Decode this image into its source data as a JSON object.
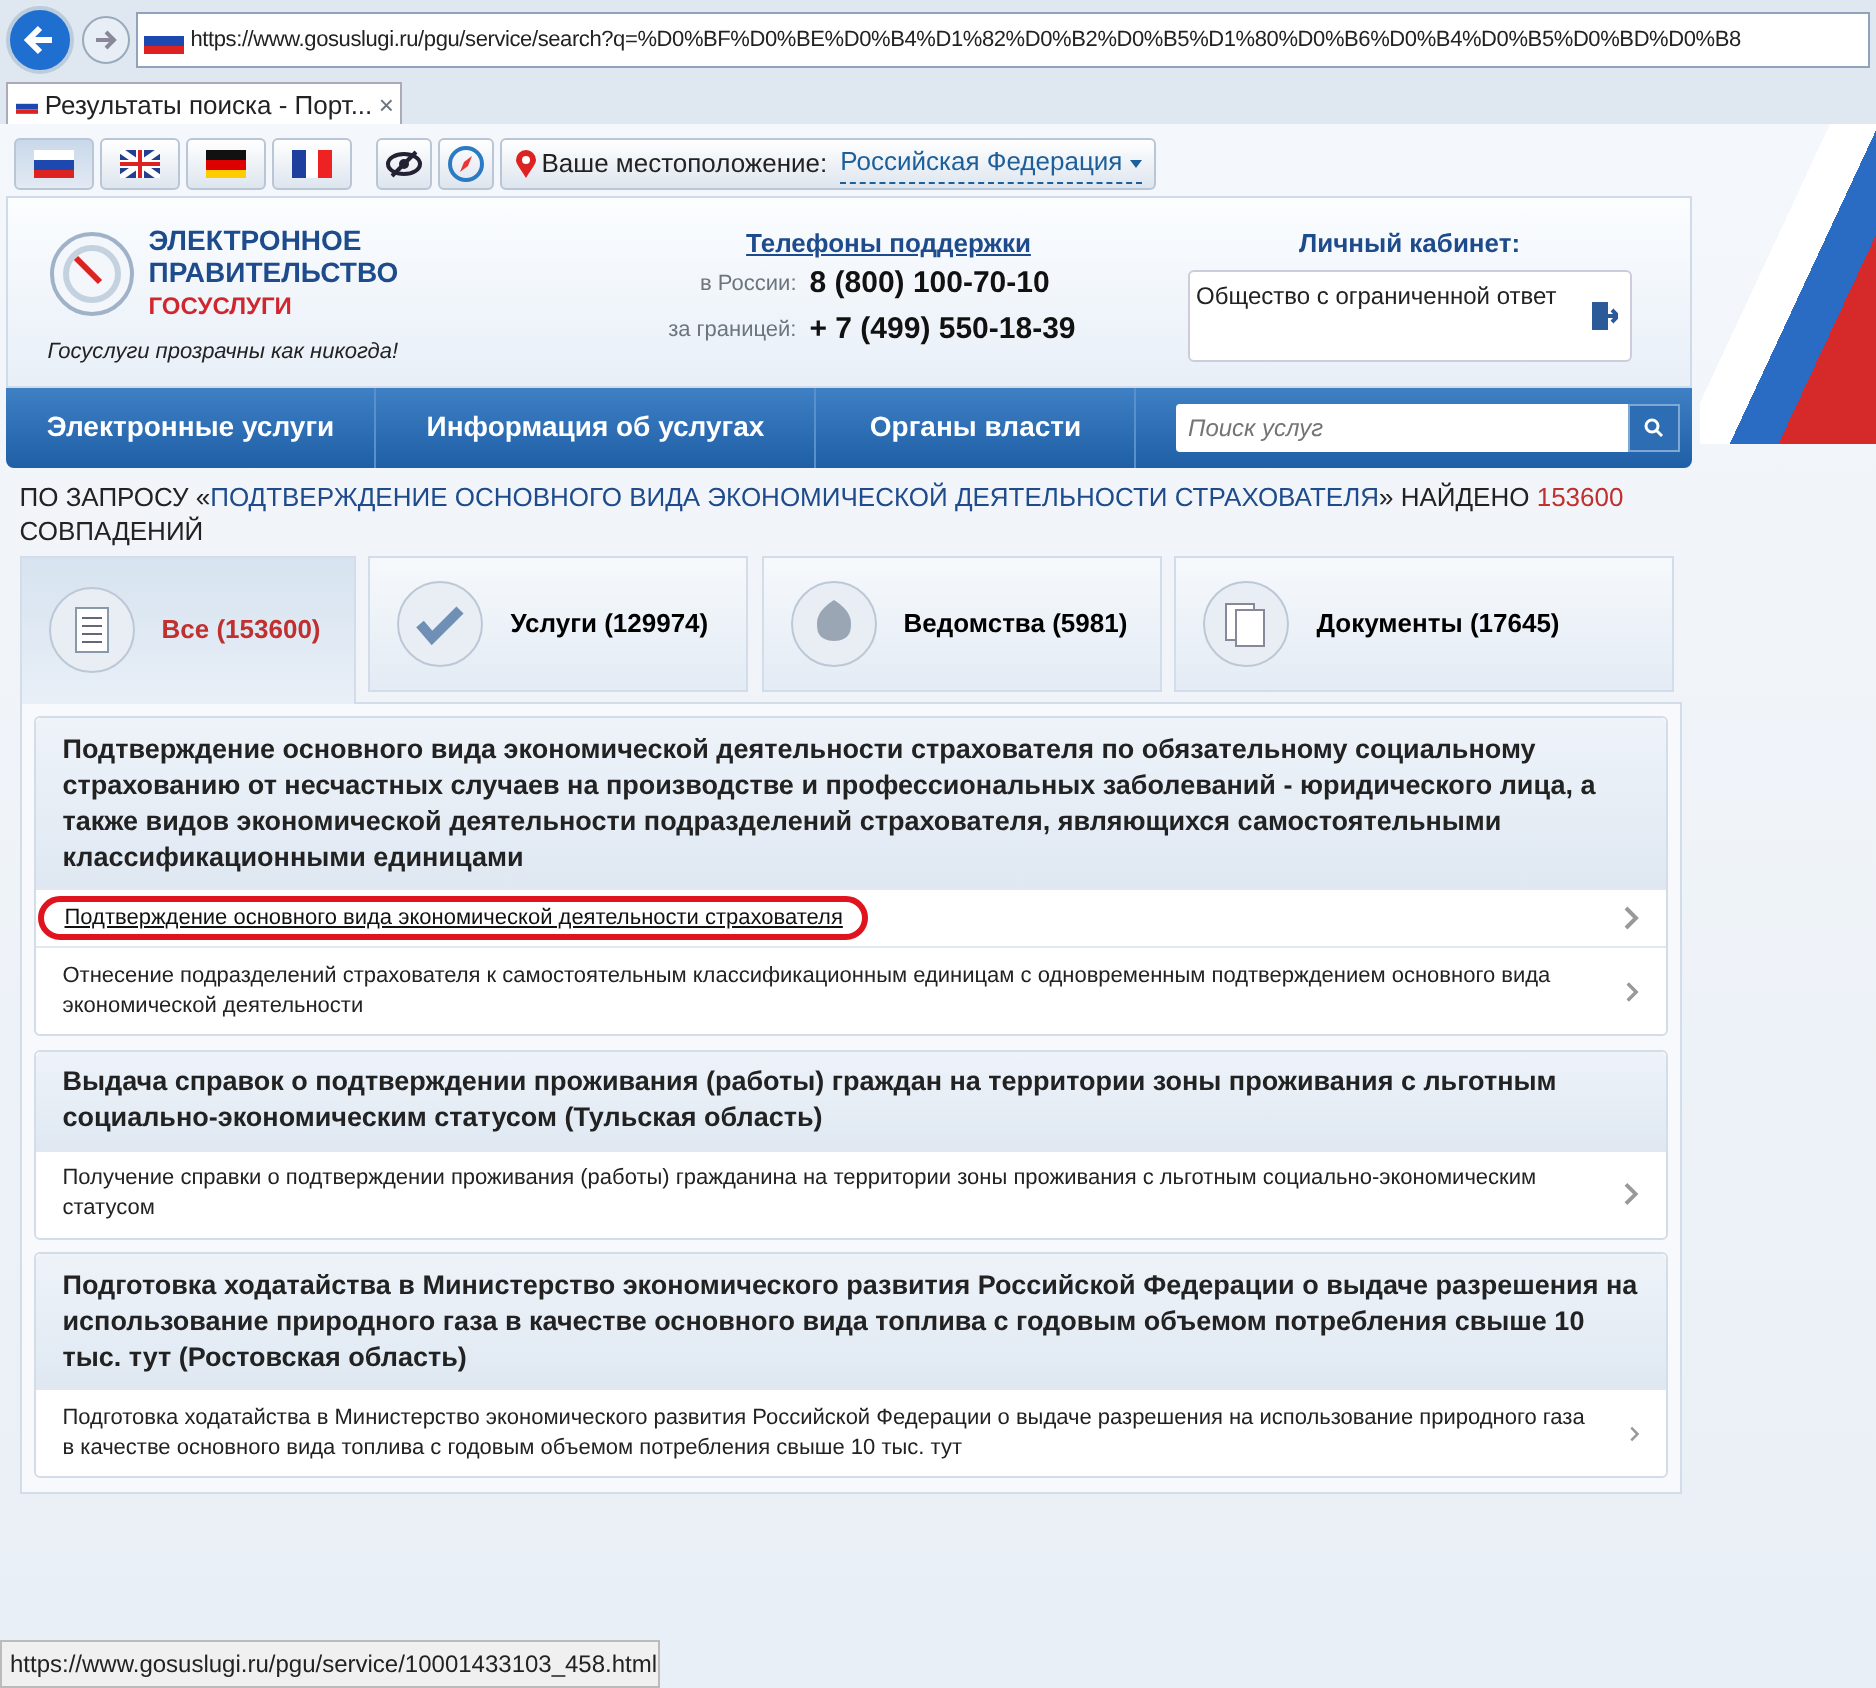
{
  "browser": {
    "address": "https://www.gosuslugi.ru/pgu/service/search?q=%D0%BF%D0%BE%D0%B4%D1%82%D0%B2%D0%B5%D1%80%D0%B6%D0%B4%D0%B5%D0%BD%D0%B8",
    "tab_title": "Результаты поиска - Порт...",
    "close": "×"
  },
  "top_bar": {
    "languages": [
      {
        "selected": true
      },
      {
        "selected": false
      },
      {
        "selected": false
      },
      {
        "selected": false
      }
    ],
    "location_label": "Ваше местоположение:",
    "location_value": "Российская Федерация"
  },
  "header": {
    "logo_lines": [
      "ЭЛЕКТРОННОЕ",
      "ПРАВИТЕЛЬСТВО",
      "ГОСУСЛУГИ"
    ],
    "slogan": "Госуслуги прозрачны как никогда!",
    "phones_title": "Телефоны поддержки",
    "phones": [
      {
        "label": "в России:",
        "number": "8 (800) 100-70-10"
      },
      {
        "label": "за границей:",
        "number": "+ 7 (499) 550-18-39"
      }
    ],
    "cabinet_title": "Личный кабинет:",
    "cabinet_org": "Общество с ограниченной ответ"
  },
  "nav": {
    "items": [
      "Электронные услуги",
      "Информация об услугах",
      "Органы власти"
    ],
    "search_placeholder": "Поиск услуг"
  },
  "result_heading": {
    "prefix": "ПО ЗАПРОСУ «",
    "query": "ПОДТВЕРЖДЕНИЕ ОСНОВНОГО ВИДА ЭКОНОМИЧЕСКОЙ ДЕЯТЕЛЬНОСТИ СТРАХОВАТЕЛЯ",
    "middle": "» НАЙДЕНО",
    "count": "153600",
    "suffix": "СОВПАДЕНИЙ"
  },
  "tabs": [
    {
      "kind": "list",
      "label": "Все (153600)",
      "selected": true
    },
    {
      "kind": "check",
      "label": "Услуги (129974)",
      "selected": false
    },
    {
      "kind": "emblem",
      "label": "Ведомства (5981)",
      "selected": false
    },
    {
      "kind": "docs",
      "label": "Документы (17645)",
      "selected": false
    }
  ],
  "groups": [
    {
      "title": "Подтверждение основного вида экономической деятельности страхователя по обязательному социальному страхованию от несчастных случаев на производстве и профессиональных заболеваний - юридического лица, а также видов экономической деятельности подразделений страхователя, являющихся самостоятельными классификационными единицами",
      "items": [
        {
          "text": "Подтверждение основного вида экономической деятельности страхователя",
          "highlighted": true
        },
        {
          "text": "Отнесение подразделений страхователя к самостоятельным классификационным единицам с одновременным подтверждением основного вида экономической деятельности",
          "highlighted": false
        }
      ]
    },
    {
      "title": "Выдача справок о подтверждении проживания (работы) граждан на территории зоны проживания с льготным социально-экономическим статусом (Тульская область)",
      "items": [
        {
          "text": "Получение справки о подтверждении проживания (работы) гражданина на территории зоны проживания с льготным социально-экономическим статусом",
          "highlighted": false
        }
      ]
    },
    {
      "title": "Подготовка ходатайства в Министерство экономического развития Российской Федерации о выдаче разрешения на использование природного газа в качестве основного вида топлива с годовым объемом потребления свыше 10 тыс. тут (Ростовская область)",
      "items": [
        {
          "text": "Подготовка ходатайства в Министерство экономического развития Российской Федерации о выдаче разрешения на использование природного газа в качестве основного вида топлива с годовым объемом потребления свыше 10 тыс. тут",
          "highlighted": false
        }
      ]
    }
  ],
  "status_bar": "https://www.gosuslugi.ru/pgu/service/10001433103_458.html"
}
